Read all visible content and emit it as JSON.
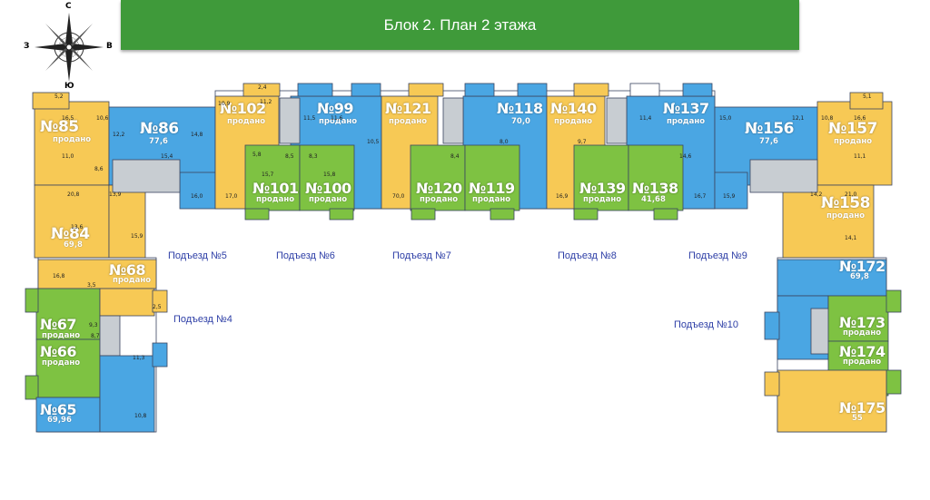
{
  "header": {
    "title": "Блок 2. План 2 этажа"
  },
  "compass": {
    "north": "С",
    "south": "Ю",
    "east": "В",
    "west": "З"
  },
  "colors": {
    "blue": "#4aa6e3",
    "green": "#7ec242",
    "yellow": "#f7c955",
    "gray": "#c8cdd2",
    "header": "#3f9a3a",
    "wall": "#3a4560",
    "entrance_text": "#2d3ea6"
  },
  "entrances": [
    "Подъезд №4",
    "Подъезд №5",
    "Подъезд №6",
    "Подъезд №7",
    "Подъезд №8",
    "Подъезд №9",
    "Подъезд №10"
  ],
  "apartments": [
    {
      "number": "№85",
      "sub": "продано"
    },
    {
      "number": "№86",
      "sub": "77,6"
    },
    {
      "number": "№84",
      "sub": "69,8"
    },
    {
      "number": "№102",
      "sub": "продано"
    },
    {
      "number": "№99",
      "sub": "продано"
    },
    {
      "number": "№101",
      "sub": "продано"
    },
    {
      "number": "№100",
      "sub": "продано"
    },
    {
      "number": "№121",
      "sub": "продано"
    },
    {
      "number": "№118",
      "sub": "70,0"
    },
    {
      "number": "№120",
      "sub": "продано"
    },
    {
      "number": "№119",
      "sub": "продано"
    },
    {
      "number": "№140",
      "sub": "продано"
    },
    {
      "number": "№137",
      "sub": "продано"
    },
    {
      "number": "№139",
      "sub": "продано"
    },
    {
      "number": "№138",
      "sub": "41,68"
    },
    {
      "number": "№156",
      "sub": "77,6"
    },
    {
      "number": "№157",
      "sub": "продано"
    },
    {
      "number": "№158",
      "sub": "продано"
    },
    {
      "number": "№68",
      "sub": "продано"
    },
    {
      "number": "№67",
      "sub": "продано"
    },
    {
      "number": "№66",
      "sub": "продано"
    },
    {
      "number": "№65",
      "sub": "69,96"
    },
    {
      "number": "№172",
      "sub": "69,8"
    },
    {
      "number": "№173",
      "sub": "продано"
    },
    {
      "number": "№174",
      "sub": "продано"
    },
    {
      "number": "№175",
      "sub": "55"
    }
  ],
  "room_labels": [
    "5,2",
    "16,5",
    "10,6",
    "11,0",
    "8,6",
    "20,8",
    "13,9",
    "13,6",
    "15,9",
    "12,2",
    "15,4",
    "14,8",
    "16,0",
    "2,4",
    "10,9",
    "11,2",
    "11,5",
    "11,6",
    "10,5",
    "17,0",
    "8,5",
    "5,8",
    "8,3",
    "15,7",
    "15,8",
    "70,0",
    "8,0",
    "14,6",
    "8,4",
    "9,7",
    "16,9",
    "16,7",
    "11,4",
    "15,0",
    "12,1",
    "15,9",
    "5,1",
    "10,8",
    "16,6",
    "11,1",
    "14,2",
    "21,0",
    "14,1",
    "16,8",
    "3,5",
    "2,5",
    "9,3",
    "8,7",
    "11,3",
    "10,8"
  ]
}
